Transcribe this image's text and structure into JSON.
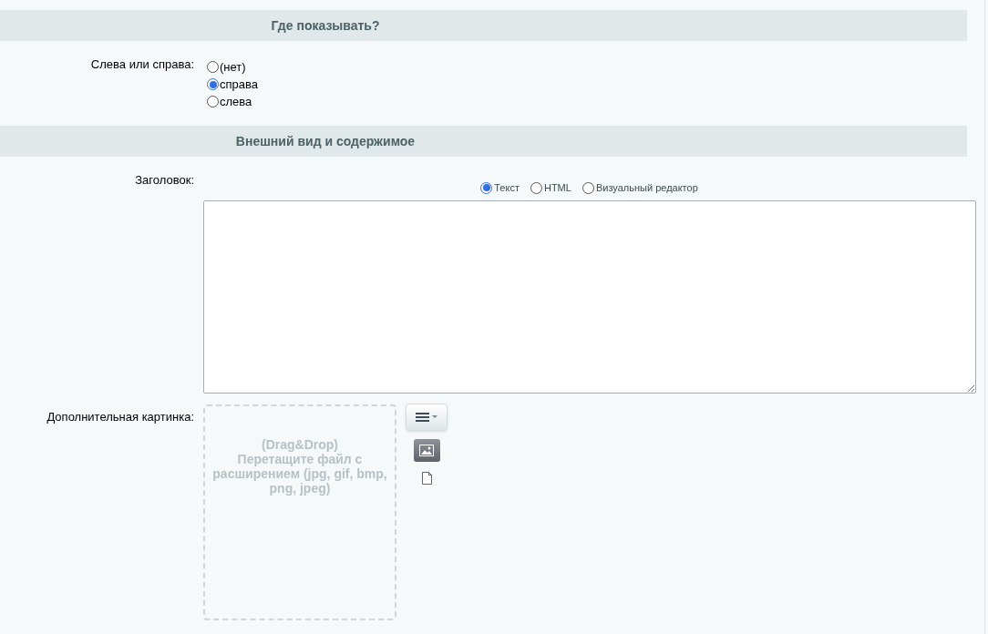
{
  "sections": [
    {
      "title": "Где показывать?",
      "fields": [
        {
          "kind": "radio_group",
          "label": "Слева или справа:",
          "options": [
            {
              "label": "(нет)",
              "selected": false
            },
            {
              "label": "справа",
              "selected": true
            },
            {
              "label": "слева",
              "selected": false
            }
          ]
        }
      ]
    },
    {
      "title": "Внешний вид и содержимое",
      "fields": [
        {
          "kind": "editor",
          "label": "Заголовок:",
          "modes": [
            {
              "label": "Текст",
              "selected": true
            },
            {
              "label": "HTML",
              "selected": false
            },
            {
              "label": "Визуальный редактор",
              "selected": false
            }
          ]
        },
        {
          "kind": "image",
          "label": "Дополнительная картинка:",
          "drop_text": [
            "(Drag&Drop)",
            "Перетащите файл с расширением (jpg, gif, bmp, png, jpeg)"
          ]
        }
      ]
    }
  ]
}
